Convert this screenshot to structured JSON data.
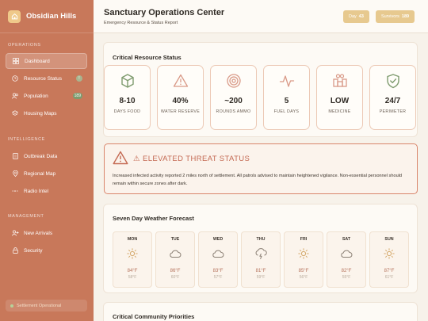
{
  "brand": {
    "name": "Obsidian Hills"
  },
  "nav": {
    "sections": [
      "OPERATIONS",
      "INTELLIGENCE",
      "MANAGEMENT"
    ],
    "items": [
      {
        "label": "Dashboard"
      },
      {
        "label": "Resource Status",
        "badge": "!"
      },
      {
        "label": "Population",
        "badge": "189"
      },
      {
        "label": "Housing Maps"
      },
      {
        "label": "Outbreak Data"
      },
      {
        "label": "Regional Map"
      },
      {
        "label": "Radio Intel"
      },
      {
        "label": "New Arrivals"
      },
      {
        "label": "Security"
      }
    ],
    "footer_status": "Settlement Operational"
  },
  "header": {
    "title": "Sanctuary Operations Center",
    "subtitle": "Emergency Resource & Status Report",
    "day_label": "Day",
    "day_value": "43",
    "survivors_label": "Survivors",
    "survivors_value": "189"
  },
  "resources": {
    "title": "Critical Resource Status",
    "cards": [
      {
        "value": "8-10",
        "label": "DAYS FOOD",
        "icon": "box-icon"
      },
      {
        "value": "40%",
        "label": "WATER RESERVE",
        "icon": "warning-icon"
      },
      {
        "value": "~200",
        "label": "ROUNDS AMMO",
        "icon": "target-icon"
      },
      {
        "value": "5",
        "label": "FUEL DAYS",
        "icon": "pulse-icon"
      },
      {
        "value": "LOW",
        "label": "MEDICINE",
        "icon": "medical-kit-icon"
      },
      {
        "value": "24/7",
        "label": "PERIMETER",
        "icon": "shield-check-icon"
      }
    ]
  },
  "alert": {
    "title": "⚠ ELEVATED THREAT STATUS",
    "text": "Increased infected activity reported 2 miles north of settlement. All patrols advised to maintain heightened vigilance. Non-essential personnel should remain within secure zones after dark."
  },
  "forecast": {
    "title": "Seven Day Weather Forecast",
    "days": [
      {
        "day": "MON",
        "high": "84°F",
        "low": "58°F",
        "icon": "sun-icon"
      },
      {
        "day": "TUE",
        "high": "86°F",
        "low": "60°F",
        "icon": "cloud-icon"
      },
      {
        "day": "WED",
        "high": "83°F",
        "low": "57°F",
        "icon": "cloud-icon"
      },
      {
        "day": "THU",
        "high": "81°F",
        "low": "59°F",
        "icon": "storm-icon"
      },
      {
        "day": "FRI",
        "high": "85°F",
        "low": "56°F",
        "icon": "sun-icon"
      },
      {
        "day": "SAT",
        "high": "82°F",
        "low": "55°F",
        "icon": "cloud-icon"
      },
      {
        "day": "SUN",
        "high": "87°F",
        "low": "61°F",
        "icon": "sun-icon"
      }
    ]
  },
  "priorities": {
    "title": "Critical Community Priorities"
  },
  "colors": {
    "sidebar": "#c8785a",
    "accent": "#c46a53",
    "pill": "#e7c98f"
  }
}
